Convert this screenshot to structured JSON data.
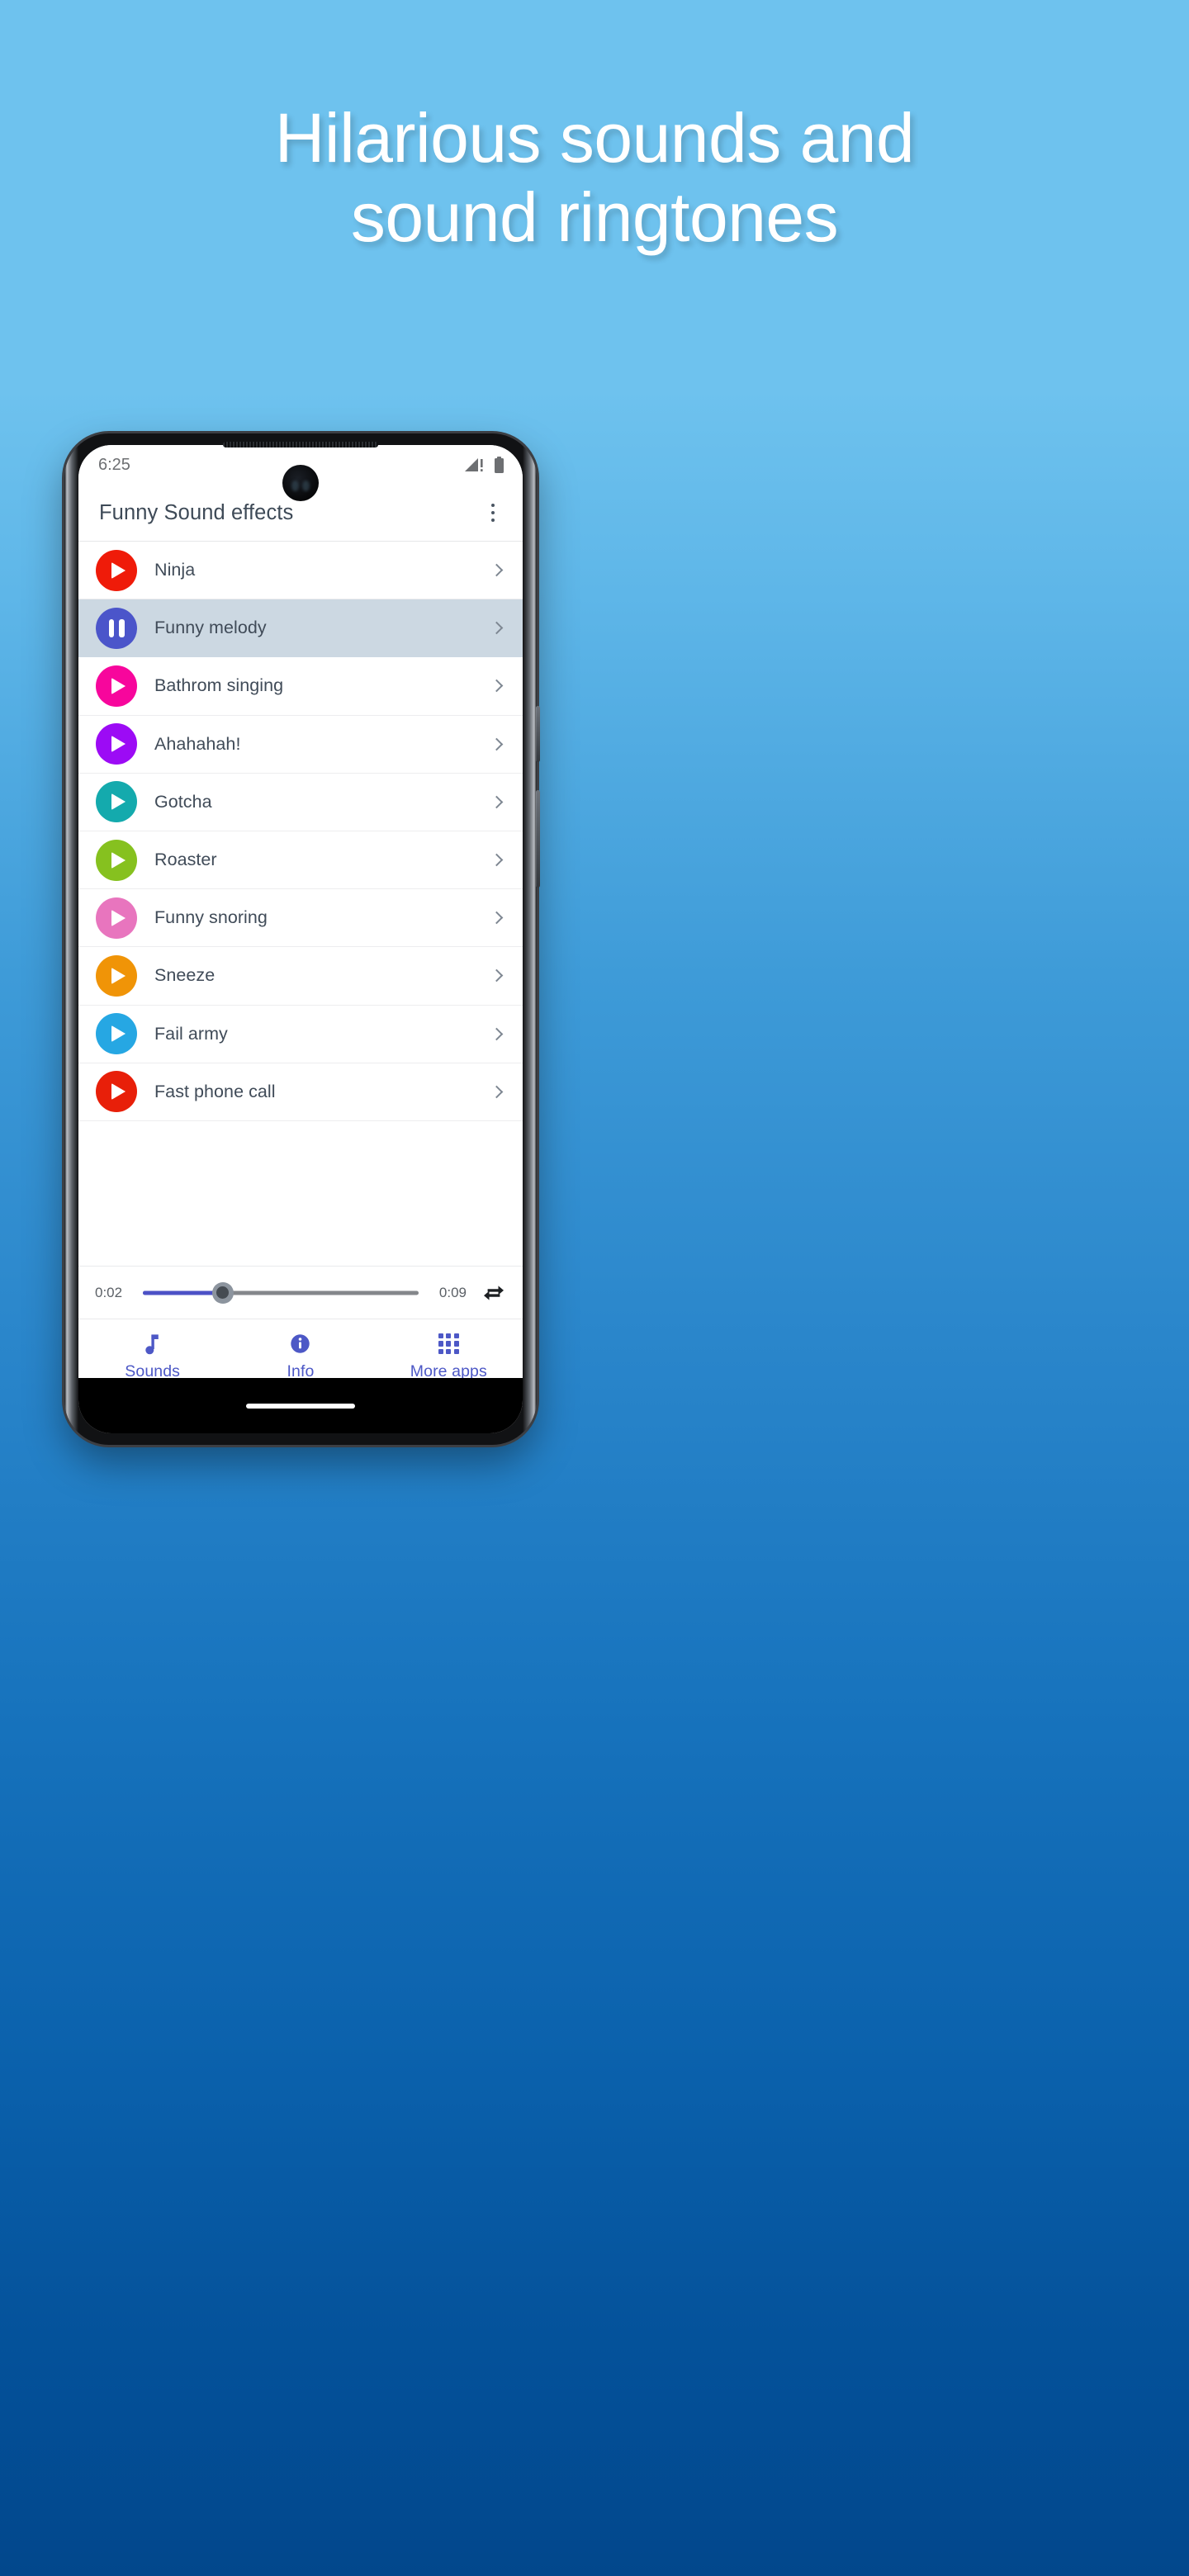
{
  "promo": {
    "headline_line1": "Hilarious sounds and",
    "headline_line2": "sound ringtones",
    "background_top_color": "#6ec2ee",
    "background_bottom_color": "#02478c",
    "headline_color": "#ffffff"
  },
  "status_bar": {
    "time": "6:25",
    "signal_icon": "signal-no-service-icon",
    "battery_icon": "battery-full-icon",
    "icon_color": "#6d6f72"
  },
  "app_bar": {
    "title": "Funny Sound effects",
    "overflow_icon": "overflow-menu-icon",
    "title_color": "#3e4a57"
  },
  "sound_list": {
    "chevron_icon": "chevron-right-icon",
    "active_row_background": "#ccd8e2",
    "items": [
      {
        "label": "Ninja",
        "color": "#ef1b09",
        "state": "play",
        "icon": "play-icon",
        "active": false
      },
      {
        "label": "Funny melody",
        "color": "#4b55ca",
        "state": "pause",
        "icon": "pause-icon",
        "active": true
      },
      {
        "label": "Bathrom singing",
        "color": "#f7069c",
        "state": "play",
        "icon": "play-icon",
        "active": false
      },
      {
        "label": "Ahahahah!",
        "color": "#9c0bf5",
        "state": "play",
        "icon": "play-icon",
        "active": false
      },
      {
        "label": "Gotcha",
        "color": "#14aaad",
        "state": "play",
        "icon": "play-icon",
        "active": false
      },
      {
        "label": "Roaster",
        "color": "#86c11f",
        "state": "play",
        "icon": "play-icon",
        "active": false
      },
      {
        "label": "Funny snoring",
        "color": "#e875be",
        "state": "play",
        "icon": "play-icon",
        "active": false
      },
      {
        "label": "Sneeze",
        "color": "#f09407",
        "state": "play",
        "icon": "play-icon",
        "active": false
      },
      {
        "label": "Fail army",
        "color": "#26a7e3",
        "state": "play",
        "icon": "play-icon",
        "active": false
      },
      {
        "label": "Fast phone call",
        "color": "#e81f09",
        "state": "play",
        "icon": "play-icon",
        "active": false
      }
    ]
  },
  "player": {
    "current_time": "0:02",
    "duration": "0:09",
    "progress_percent": 29,
    "loop_icon": "repeat-loop-icon",
    "progress_color": "#4c51c6",
    "track_color": "#84878b"
  },
  "bottom_nav": {
    "accent_color": "#4d58c6",
    "items": [
      {
        "label": "Sounds",
        "icon": "music-note-icon"
      },
      {
        "label": "Info",
        "icon": "info-circle-icon"
      },
      {
        "label": "More apps",
        "icon": "apps-grid-icon"
      }
    ]
  }
}
